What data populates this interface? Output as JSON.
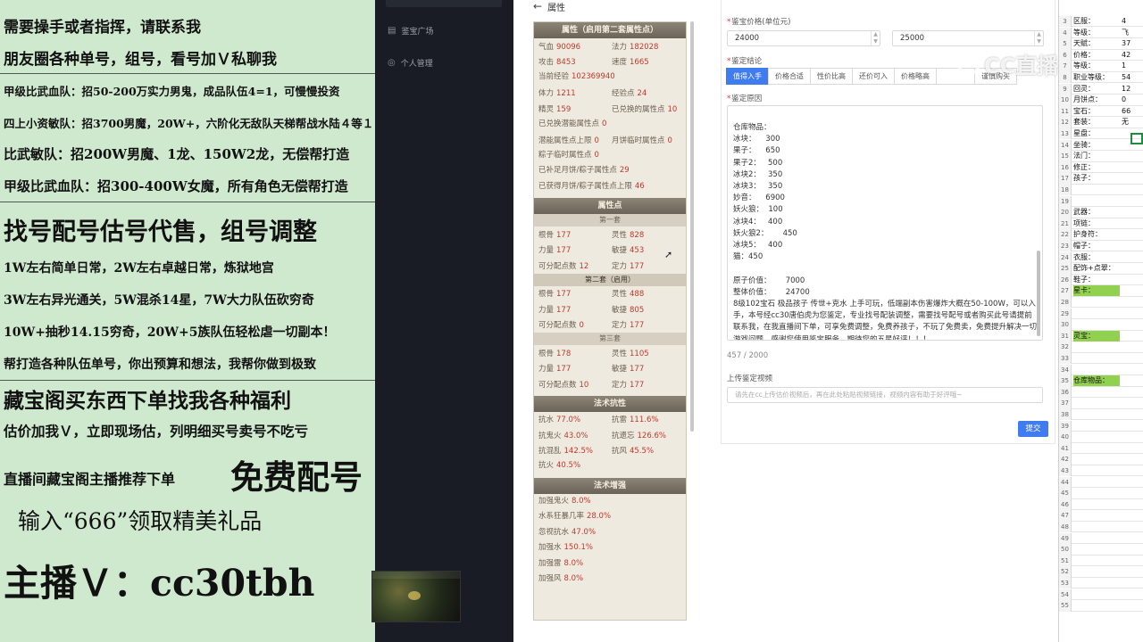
{
  "promo": {
    "lines": [
      "需要操手或者指挥，请联系我",
      "朋友圈各种单号，组号，看号加Ｖ私聊我",
      "甲级比武血队：招50-200万实力男鬼，成品队伍4=1，可慢慢投资",
      "四上小资敏队：招3700男魔，20W+，六阶化无敌队天梯帮战水陆４等１",
      "比武敏队：招200W男魔、1龙、150W2龙，无偿帮打造",
      "甲级比武血队：招300-400W女魔，所有角色无偿帮打造",
      "找号配号估号代售，组号调整",
      "1W左右简单日常，2W左右卓越日常，炼狱地宫",
      "3W左右异光通关，5W混杀14星，7W大力队伍砍穷奇",
      "10W+抽秒14.15穷奇，20W+5族队伍轻松虐一切副本！",
      "帮打造各种队伍单号，你出预算和想法，我帮你做到极致",
      "藏宝阁买东西下单找我各种福利",
      "估价加我Ｖ，立即现场估，列明细买号卖号不吃亏",
      "直播间藏宝阁主播推荐下单",
      "免费配号",
      "输入“666”领取精美礼品",
      "主播Ｖ：cc30tbh"
    ]
  },
  "sidebar": {
    "items": [
      {
        "icon": "document-icon",
        "label": "鉴宝广场"
      },
      {
        "icon": "user-icon",
        "label": "个人管理"
      }
    ]
  },
  "attr": {
    "window_title": "属性",
    "header_tabs": "属性（启用第二套属性点）",
    "basic_pairs": [
      [
        "气血",
        "90096",
        "法力",
        "182028"
      ],
      [
        "攻击",
        "8453",
        "速度",
        "1665"
      ]
    ],
    "exp_label": "当前经验",
    "exp_value": "102369940",
    "mid_pairs": [
      [
        "体力",
        "1211",
        "经验点",
        "24"
      ],
      [
        "精灵",
        "159",
        "已兑换的属性点",
        "10"
      ]
    ],
    "singles": [
      [
        "已兑换潜能属性点",
        "0"
      ]
    ],
    "mid_pairs2": [
      [
        "潜能属性点上限",
        "0",
        "月饼临时属性点",
        "0"
      ]
    ],
    "singles2": [
      [
        "粽子临时属性点",
        "0"
      ],
      [
        "已补足月饼/粽子属性点",
        "29"
      ],
      [
        "已获得月饼/粽子属性点上限",
        "46"
      ]
    ],
    "points_title": "属性点",
    "sets": [
      {
        "title": "第一套",
        "active": false,
        "rows": [
          [
            "根骨",
            "177",
            "灵性",
            "828"
          ],
          [
            "力量",
            "177",
            "敏捷",
            "453"
          ],
          [
            "可分配点数",
            "12",
            "定力",
            "177"
          ]
        ]
      },
      {
        "title": "第二套（启用）",
        "active": true,
        "rows": [
          [
            "根骨",
            "177",
            "灵性",
            "488"
          ],
          [
            "力量",
            "177",
            "敏捷",
            "805"
          ],
          [
            "可分配点数",
            "0",
            "定力",
            "177"
          ]
        ]
      },
      {
        "title": "第三套",
        "active": false,
        "rows": [
          [
            "根骨",
            "178",
            "灵性",
            "1105"
          ],
          [
            "力量",
            "177",
            "敏捷",
            "177"
          ],
          [
            "可分配点数",
            "10",
            "定力",
            "177"
          ]
        ]
      }
    ],
    "resist_title": "法术抗性",
    "resist_rows": [
      [
        "抗水",
        "77.0%",
        "抗雷",
        "111.6%"
      ],
      [
        "抗鬼火",
        "43.0%",
        "抗遗忘",
        "126.6%"
      ],
      [
        "抗混乱",
        "142.5%",
        "抗风",
        "45.5%"
      ]
    ],
    "resist_single": [
      "抗火",
      "40.5%"
    ],
    "boost_title": "法术增强",
    "boost_rows": [
      [
        "加强鬼火",
        "8.0%"
      ],
      [
        "水系狂暴几率",
        "28.0%"
      ],
      [
        "忽视抗水",
        "47.0%"
      ],
      [
        "加强水",
        "150.1%"
      ],
      [
        "加强雷",
        "8.0%"
      ],
      [
        "加强风",
        "8.0%"
      ]
    ]
  },
  "form": {
    "price_label": "鉴宝价格(单位元)",
    "price_min": "24000",
    "price_max": "25000",
    "conclusion_label": "鉴定结论",
    "choices": [
      "值得入手",
      "价格合适",
      "性价比高",
      "还价可入",
      "价格略高",
      "",
      "谨慎购买"
    ],
    "reason_label": "鉴定原因",
    "reason_text": "仓库物品：\n冰块：    300\n果子：    650\n果子2：   500\n冰块2：   350\n冰块3：   350\n妙音：    6900\n妖火狼：  100\n冰块4：   400\n妖火狼2：      450\n冰块5：   400\n猫：450\n\n原子价值：      7000\n整体价值：      24700\n8级102宝石 极品孩子 传世+克水 上手可玩，低端副本伤害爆炸大概在50-100W，可以入手，本号经cc30唐伯虎为您鉴定，专业找号配装调整，需要找号配号或者购买此号请提前联系我，在我直播间下单，可享免费调整，免费养孩子，不玩了免费卖，免费提升解决一切游戏问题，感谢您使用鉴宝服务，期待您的五星好评！！！",
    "counter": "457 / 2000",
    "video_label": "上传鉴定视频",
    "video_placeholder": "请先在cc上传估价视频后，再在此处粘贴视频链接，视频内容有助于好评哦~",
    "submit_label": "提交"
  },
  "watermark": "CC直播",
  "sheet": {
    "rows": [
      [
        "3",
        "区服：",
        "4"
      ],
      [
        "4",
        "等级：",
        "飞"
      ],
      [
        "5",
        "天赋：",
        "37"
      ],
      [
        "6",
        "价格：",
        "42"
      ],
      [
        "7",
        "等级：",
        "1"
      ],
      [
        "8",
        "职业等级：",
        "54"
      ],
      [
        "9",
        "回灵：",
        "12"
      ],
      [
        "10",
        "月饼点：",
        "0"
      ],
      [
        "11",
        "宝石：",
        "66"
      ],
      [
        "12",
        "套装：",
        "无"
      ],
      [
        "13",
        "星盘：",
        ""
      ],
      [
        "14",
        "坐骑：",
        ""
      ],
      [
        "15",
        "法门：",
        ""
      ],
      [
        "16",
        "修正：",
        ""
      ],
      [
        "17",
        "孩子：",
        ""
      ],
      [
        "18",
        "",
        ""
      ],
      [
        "19",
        "",
        ""
      ],
      [
        "20",
        "武器：",
        ""
      ],
      [
        "21",
        "项链：",
        ""
      ],
      [
        "22",
        "护身符：",
        ""
      ],
      [
        "23",
        "帽子：",
        ""
      ],
      [
        "24",
        "衣服：",
        ""
      ],
      [
        "25",
        "配饰+点翠：",
        ""
      ],
      [
        "26",
        "鞋子：",
        ""
      ],
      [
        "27",
        "星卡：",
        ""
      ],
      [
        "28",
        "",
        ""
      ],
      [
        "29",
        "",
        ""
      ],
      [
        "30",
        "",
        ""
      ],
      [
        "31",
        "灵宝：",
        ""
      ],
      [
        "32",
        "",
        ""
      ],
      [
        "33",
        "",
        ""
      ],
      [
        "34",
        "",
        ""
      ],
      [
        "35",
        "仓库物品：",
        ""
      ],
      [
        "36",
        "",
        ""
      ],
      [
        "37",
        "",
        ""
      ],
      [
        "38",
        "",
        ""
      ],
      [
        "39",
        "",
        ""
      ],
      [
        "40",
        "",
        ""
      ],
      [
        "41",
        "",
        ""
      ],
      [
        "42",
        "",
        ""
      ],
      [
        "43",
        "",
        ""
      ],
      [
        "44",
        "",
        ""
      ],
      [
        "45",
        "",
        ""
      ],
      [
        "46",
        "",
        ""
      ],
      [
        "47",
        "",
        ""
      ],
      [
        "48",
        "",
        ""
      ],
      [
        "49",
        "",
        ""
      ],
      [
        "50",
        "",
        ""
      ],
      [
        "51",
        "",
        ""
      ],
      [
        "52",
        "",
        ""
      ],
      [
        "53",
        "",
        ""
      ],
      [
        "54",
        "",
        ""
      ],
      [
        "55",
        "",
        ""
      ]
    ],
    "highlight_rows": [
      "27",
      "31",
      "35"
    ]
  }
}
